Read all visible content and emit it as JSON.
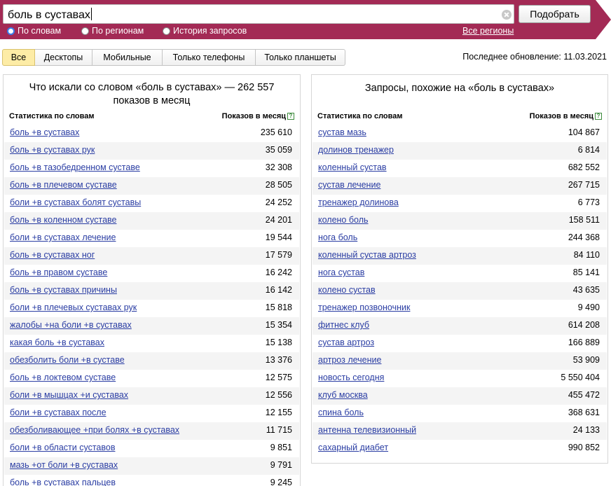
{
  "header": {
    "colors": {
      "band": "#a32a55",
      "radio_on": "#3a7be8"
    },
    "search": {
      "value": "боль в суставах"
    },
    "submit_label": "Подобрать",
    "clear_icon": "circle-x-icon",
    "radios": [
      {
        "label": "По словам",
        "selected": true
      },
      {
        "label": "По регионам",
        "selected": false
      },
      {
        "label": "История запросов",
        "selected": false
      }
    ],
    "regions_link": "Все регионы"
  },
  "tabs": [
    {
      "label": "Все",
      "active": true
    },
    {
      "label": "Десктопы",
      "active": false
    },
    {
      "label": "Мобильные",
      "active": false
    },
    {
      "label": "Только телефоны",
      "active": false
    },
    {
      "label": "Только планшеты",
      "active": false
    }
  ],
  "last_update": "Последнее обновление: 11.03.2021",
  "left_panel": {
    "title": "Что искали со словом «боль в суставах» — 262 557 показов в месяц",
    "col_phrase": "Статистика по словам",
    "col_count": "Показов в месяц",
    "help_icon": "help-question-icon",
    "rows": [
      {
        "phrase": "боль +в суставах",
        "count": "235 610"
      },
      {
        "phrase": "боль +в суставах рук",
        "count": "35 059"
      },
      {
        "phrase": "боль +в тазобедренном суставе",
        "count": "32 308"
      },
      {
        "phrase": "боль +в плечевом суставе",
        "count": "28 505"
      },
      {
        "phrase": "боли +в суставах болят суставы",
        "count": "24 252"
      },
      {
        "phrase": "боль +в коленном суставе",
        "count": "24 201"
      },
      {
        "phrase": "боли +в суставах лечение",
        "count": "19 544"
      },
      {
        "phrase": "боль +в суставах ног",
        "count": "17 579"
      },
      {
        "phrase": "боль +в правом суставе",
        "count": "16 242"
      },
      {
        "phrase": "боль +в суставах причины",
        "count": "16 142"
      },
      {
        "phrase": "боли +в плечевых суставах рук",
        "count": "15 818"
      },
      {
        "phrase": "жалобы +на боли +в суставах",
        "count": "15 354"
      },
      {
        "phrase": "какая боль +в суставах",
        "count": "15 138"
      },
      {
        "phrase": "обезболить боли +в суставе",
        "count": "13 376"
      },
      {
        "phrase": "боль +в локтевом суставе",
        "count": "12 575"
      },
      {
        "phrase": "боли +в мышцах +и суставах",
        "count": "12 556"
      },
      {
        "phrase": "боли +в суставах после",
        "count": "12 155"
      },
      {
        "phrase": "обезболивающее +при болях +в суставах",
        "count": "11 715"
      },
      {
        "phrase": "боли +в области суставов",
        "count": "9 851"
      },
      {
        "phrase": "мазь +от боли +в суставах",
        "count": "9 791"
      },
      {
        "phrase": "боль +в суставах пальцев",
        "count": "9 245"
      }
    ]
  },
  "right_panel": {
    "title": "Запросы, похожие на «боль в суставах»",
    "col_phrase": "Статистика по словам",
    "col_count": "Показов в месяц",
    "help_icon": "help-question-icon",
    "rows": [
      {
        "phrase": "сустав мазь",
        "count": "104 867"
      },
      {
        "phrase": "долинов тренажер",
        "count": "6 814"
      },
      {
        "phrase": "коленный сустав",
        "count": "682 552"
      },
      {
        "phrase": "сустав лечение",
        "count": "267 715"
      },
      {
        "phrase": "тренажер долинова",
        "count": "6 773"
      },
      {
        "phrase": "колено боль",
        "count": "158 511"
      },
      {
        "phrase": "нога боль",
        "count": "244 368"
      },
      {
        "phrase": "коленный сустав артроз",
        "count": "84 110"
      },
      {
        "phrase": "нога сустав",
        "count": "85 141"
      },
      {
        "phrase": "колено сустав",
        "count": "43 635"
      },
      {
        "phrase": "тренажер позвоночник",
        "count": "9 490"
      },
      {
        "phrase": "фитнес клуб",
        "count": "614 208"
      },
      {
        "phrase": "сустав артроз",
        "count": "166 889"
      },
      {
        "phrase": "артроз лечение",
        "count": "53 909"
      },
      {
        "phrase": "новость сегодня",
        "count": "5 550 404"
      },
      {
        "phrase": "клуб москва",
        "count": "455 472"
      },
      {
        "phrase": "спина боль",
        "count": "368 631"
      },
      {
        "phrase": "антенна телевизионный",
        "count": "24 133"
      },
      {
        "phrase": "сахарный диабет",
        "count": "990 852"
      }
    ]
  }
}
